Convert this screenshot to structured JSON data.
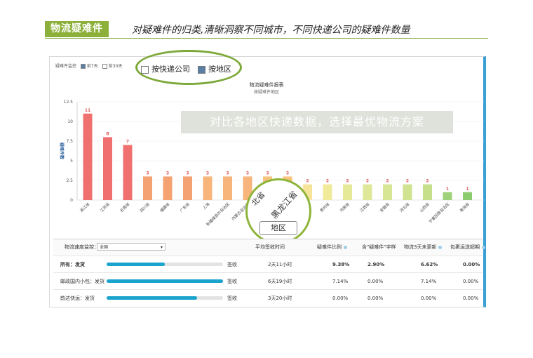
{
  "header": {
    "tag": "物流疑难件",
    "subtitle": "对疑难件的归类,清晰洞察不同城市，不同快递公司的疑难件数量"
  },
  "topbar": {
    "label": "疑难件监控",
    "opt7": "前7天",
    "opt30": "前30天",
    "by_company": "按快递公司",
    "by_region": "按地区"
  },
  "banner": "对比各地区快递数据，选择最优物流方案",
  "magnifier": {
    "text1": "北省",
    "text2": "黑龙江省",
    "box_label": "地区"
  },
  "chart_data": {
    "type": "bar",
    "title": "物流疑难件报表",
    "subtitle": "按疑难件地区",
    "ylabel": "疑难件数",
    "ylim": [
      0,
      12.5
    ],
    "yticks": [
      "0",
      "2.5",
      "5",
      "7.5",
      "10",
      "12.5"
    ],
    "categories": [
      "浙江省",
      "江苏省",
      "云南省",
      "四川省",
      "福建省",
      "广东省",
      "上海",
      "新疆维吾尔自治区",
      "内蒙古自治区",
      "北省",
      "黑龙江省",
      "湖北省",
      "贵州省",
      "河南省",
      "江西省",
      "安徽省",
      "河北省",
      "山西省",
      "宁夏回族自治区",
      "青海省"
    ],
    "values": [
      11,
      8,
      7,
      3,
      3,
      3,
      3,
      3,
      3,
      3,
      3,
      2,
      2,
      2,
      2,
      2,
      2,
      2,
      1,
      1
    ],
    "colors": [
      "#f07070",
      "#f07070",
      "#f07070",
      "#f5a273",
      "#f5a273",
      "#f5a273",
      "#f7b57c",
      "#f7b57c",
      "#f7b57c",
      "#f8c27f",
      "#f8c27f",
      "#f5e49a",
      "#f0ea9a",
      "#e6ea98",
      "#dfe898",
      "#d7e694",
      "#cfe390",
      "#c5df8a",
      "#9fd07a",
      "#8ccc6e"
    ],
    "label_color": "#e05555"
  },
  "table": {
    "filter_label": "物流速度监控：",
    "filter_value": "全国",
    "headers": [
      "平均签收时间",
      "疑难件比例",
      "含\"疑难件\"字样",
      "物流3天未更新",
      "包裹运送超期"
    ],
    "rows": [
      {
        "name": "所有：发货",
        "progress": 0.5,
        "status": "签收",
        "time": "2天11小时",
        "ratio": "9.38%",
        "keyword": "2.90%",
        "stale": "6.62%",
        "overdue": "0.00%"
      },
      {
        "name": "邮政国内小包：发货",
        "progress": 1.0,
        "status": "签收",
        "time": "6天19小时",
        "ratio": "7.14%",
        "keyword": "0.00%",
        "stale": "7.14%",
        "overdue": "0.00%"
      },
      {
        "name": "韵达快运：发货",
        "progress": 0.78,
        "status": "签收",
        "time": "3天20小时",
        "ratio": "0.00%",
        "keyword": "0.00%",
        "stale": "0.00%",
        "overdue": "0.00%"
      }
    ]
  }
}
